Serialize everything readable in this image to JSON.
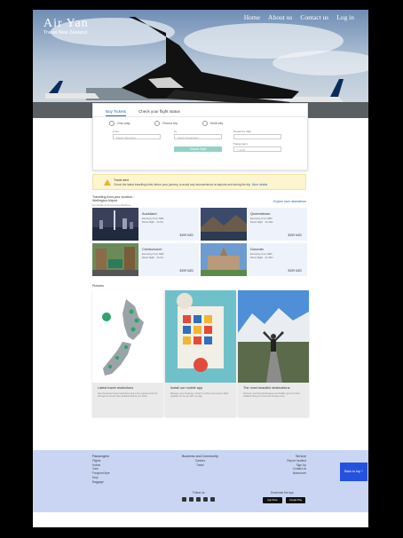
{
  "brand": {
    "name": "Air Yan",
    "tagline": "Travel New Zealand"
  },
  "nav": {
    "home": "Home",
    "about": "About us",
    "contact": "Contact us",
    "login": "Log in"
  },
  "search": {
    "tab_ticket": "Buy Tickets",
    "tab_status": "Check your flight status",
    "opt_oneway": "One-way",
    "opt_round": "Round trip",
    "opt_multi": "Multi-city",
    "from_label": "From",
    "from_placeholder": "Select departure",
    "to_label": "To",
    "to_placeholder": "Select destination",
    "depart_label": "Departure date",
    "passengers_label": "Passengers",
    "passengers_value": "1 adult",
    "button": "Search flight"
  },
  "notice": {
    "title": "Travel alert",
    "text": "Check the latest travelling hints before your journey, to avoid any inconvenience at airports and during the trip.",
    "link": "More details"
  },
  "travel": {
    "line1": "Travelling from your location...",
    "line2": "Wellington Airport",
    "line3": "Hot deals and recommendations",
    "explore": "Explore more destinations"
  },
  "destinations": [
    {
      "city": "Auckland",
      "sub": "Economy from NZD",
      "meta": "Direct flight · 1h 5m",
      "price": "$199 NZD"
    },
    {
      "city": "Queenstown",
      "sub": "Economy from NZD",
      "meta": "Direct flight · 1h 20m",
      "price": "$199 NZD"
    },
    {
      "city": "Christchurch",
      "sub": "Economy from NZD",
      "meta": "Direct flight · 1h 0m",
      "price": "$199 NZD"
    },
    {
      "city": "Dunedin",
      "sub": "Economy from NZD",
      "meta": "Direct flight · 1h 15m",
      "price": "$199 NZD"
    }
  ],
  "pictures": {
    "heading": "Pictures",
    "items": [
      {
        "title": "Latest travel restrictions",
        "desc": "See the latest travel restrictions and entry requirements for all regions across New Zealand before you book."
      },
      {
        "title": "Install our mobile app",
        "desc": "Manage your bookings, check in online and receive flight updates on the go with our app."
      },
      {
        "title": "The most beautiful destinations",
        "desc": "Discover stunning landscapes and hidden gems in New Zealand that you must visit at least once."
      }
    ]
  },
  "footer": {
    "passengers": {
      "heading": "Passengers",
      "items": [
        "Flights",
        "Hotels",
        "Cars",
        "Frequent flyer",
        "Help",
        "Baggage"
      ]
    },
    "business": {
      "heading": "Business and Community",
      "items": [
        "Careers",
        "Travel"
      ]
    },
    "service": {
      "heading": "Service",
      "items": [
        "Report Incident",
        "Sign Up",
        "Contact us",
        "Newsroom"
      ]
    },
    "follow": "Follow us",
    "download": "Download the app",
    "appstore": "App Store",
    "googleplay": "Google Play"
  },
  "backtop": "Back to top"
}
